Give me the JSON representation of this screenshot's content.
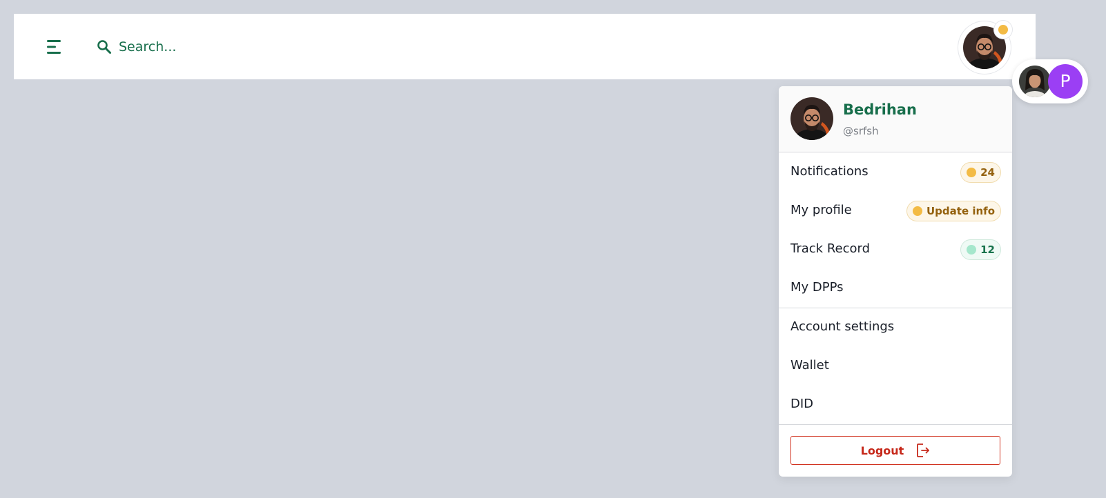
{
  "header": {
    "search_placeholder": "Search...",
    "menu_icon": "hamburger-menu-icon",
    "search_icon": "search-icon"
  },
  "account_switcher": {
    "second_account_initial": "P"
  },
  "user": {
    "name": "Bedrihan",
    "handle": "@srfsh"
  },
  "menu": {
    "primary": [
      {
        "label": "Notifications",
        "badge": "24",
        "badge_color": "#f3bb45"
      },
      {
        "label": "My profile",
        "badge": "Update info",
        "badge_color": "#f3bb45"
      },
      {
        "label": "Track Record",
        "badge": "12",
        "badge_color": "#a5e7cc"
      },
      {
        "label": "My DPPs"
      }
    ],
    "secondary": [
      {
        "label": "Account settings"
      },
      {
        "label": "Wallet"
      },
      {
        "label": "DID"
      }
    ],
    "logout_label": "Logout"
  },
  "colors": {
    "brand_green": "#176e4b",
    "warning_yellow": "#f3bb45",
    "logout_red": "#c6281a",
    "accent_purple": "#9b3ff4"
  }
}
